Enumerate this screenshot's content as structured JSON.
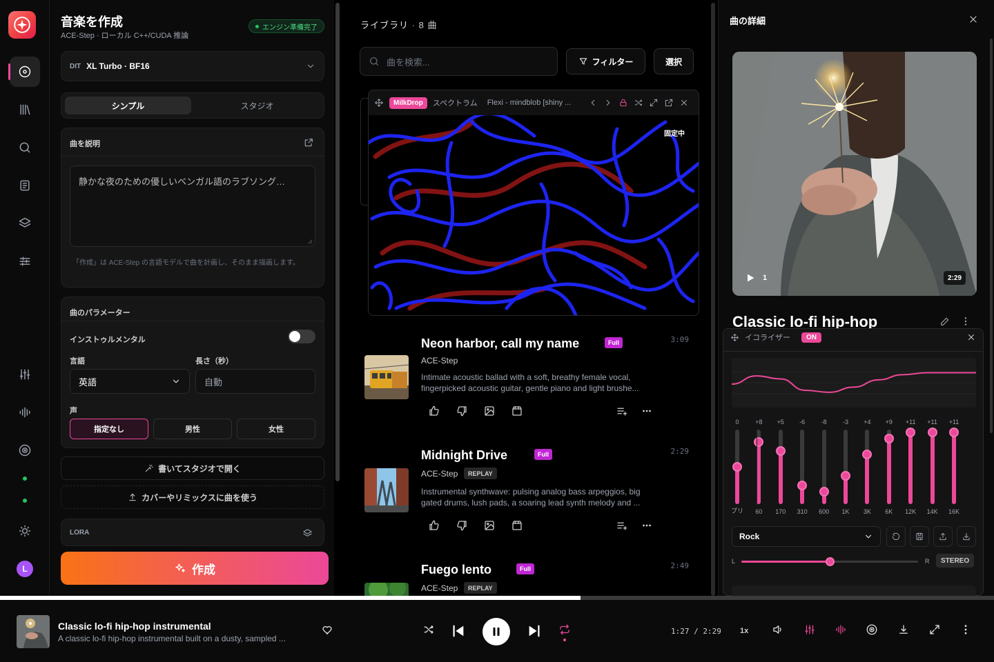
{
  "create": {
    "title": "音楽を作成",
    "subtitle": "ACE-Step · ローカル C++/CUDA 推論",
    "engine_status": "エンジン準備完了",
    "model": {
      "tag": "DIT",
      "name": "XL Turbo · BF16"
    },
    "mode_tabs": [
      {
        "label": "シンプル",
        "active": true
      },
      {
        "label": "スタジオ",
        "active": false
      }
    ],
    "describe": {
      "header": "曲を説明",
      "prompt_value": "静かな夜のための優しいベンガル語のラブソング…",
      "hint": "「作成」は ACE-Step の言語モデルで曲を計画し、そのまま描画します。"
    },
    "params": {
      "header": "曲のパラメーター",
      "instrumental_label": "インストゥルメンタル",
      "instrumental_on": false,
      "language_label": "言語",
      "language_value": "英語",
      "length_label": "長さ（秒）",
      "length_placeholder": "自動",
      "voice_label": "声",
      "voices": [
        {
          "label": "指定なし",
          "active": true
        },
        {
          "label": "男性",
          "active": false
        },
        {
          "label": "女性",
          "active": false
        }
      ]
    },
    "write_studio_label": "書いてスタジオで開く",
    "cover_remix_label": "カバーやリミックスに曲を使う",
    "lora_label": "LORA",
    "generate_label": "作成"
  },
  "library": {
    "title": "ライブラリ",
    "count": "8 曲",
    "search_placeholder": "曲を検索...",
    "filter_label": "フィルター",
    "select_label": "選択",
    "visualizer": {
      "engine": "MilkDrop",
      "mode": "スペクトラム",
      "preset": "Flexi - mindblob [shiny ...",
      "pinned": "固定中"
    },
    "tracks": [
      {
        "title": "Neon harbor, call my name",
        "badge": "Full",
        "duration": "3:09",
        "artist": "ACE-Step",
        "replay": "",
        "description": "Intimate acoustic ballad with a soft, breathy female vocal, fingerpicked acoustic guitar, gentle piano and light brushe..."
      },
      {
        "title": "Midnight Drive",
        "badge": "Full",
        "duration": "2:29",
        "artist": "ACE-Step",
        "replay": "REPLAY",
        "description": "Instrumental synthwave: pulsing analog bass arpeggios, big gated drums, lush pads, a soaring lead synth melody and ..."
      },
      {
        "title": "Fuego lento",
        "badge": "Full",
        "duration": "2:49",
        "artist": "ACE-Step",
        "replay": "REPLAY",
        "description": ""
      }
    ]
  },
  "detail": {
    "header": "曲の詳細",
    "play_count": "1",
    "cover_duration": "2:29",
    "title": "Classic lo-fi hip-hop",
    "equalizer": {
      "title": "イコライザー",
      "state": "ON",
      "bands": [
        {
          "gain": "0",
          "freq": "プリ",
          "level": 0.5
        },
        {
          "gain": "+8",
          "freq": "60",
          "level": 0.83
        },
        {
          "gain": "+5",
          "freq": "170",
          "level": 0.71
        },
        {
          "gain": "-6",
          "freq": "310",
          "level": 0.25
        },
        {
          "gain": "-8",
          "freq": "600",
          "level": 0.17
        },
        {
          "gain": "-3",
          "freq": "1K",
          "level": 0.38
        },
        {
          "gain": "+4",
          "freq": "3K",
          "level": 0.67
        },
        {
          "gain": "+9",
          "freq": "6K",
          "level": 0.88
        },
        {
          "gain": "+11",
          "freq": "12K",
          "level": 0.96
        },
        {
          "gain": "+11",
          "freq": "14K",
          "level": 0.96
        },
        {
          "gain": "+11",
          "freq": "16K",
          "level": 0.96
        }
      ],
      "preset": "Rock",
      "balance_left": "L",
      "balance_right": "R",
      "balance_value": 0.5,
      "stereo_label": "STEREO"
    }
  },
  "player": {
    "title": "Classic lo-fi hip-hop instrumental",
    "description": "A classic lo-fi hip-hop instrumental built on a dusty, sampled ...",
    "time": "1:27 / 2:29",
    "progress": 0.584,
    "rate": "1x"
  },
  "colors": {
    "accent": "#ec4899",
    "generate_start": "#f97316",
    "online": "#22c55e"
  }
}
